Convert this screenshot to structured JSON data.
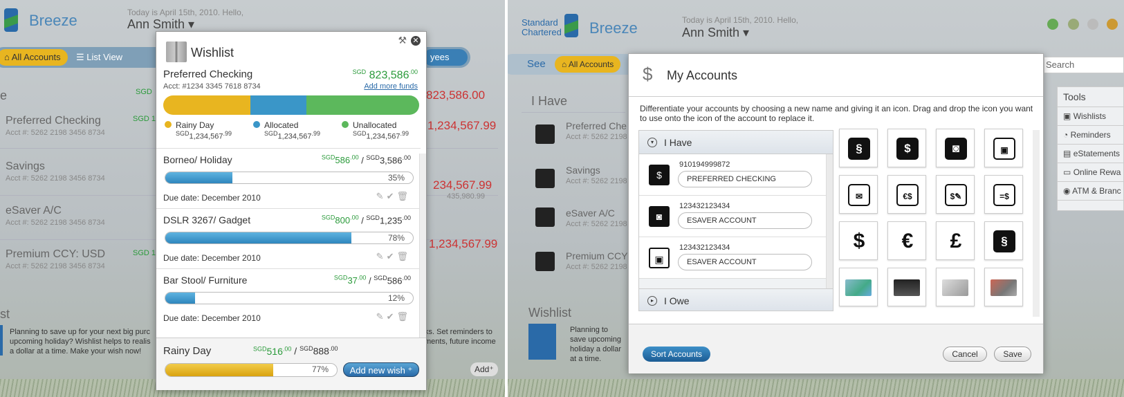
{
  "left": {
    "brand": "Breeze",
    "greeting": "Today is April 15th, 2010. Hello,",
    "user": "Ann Smith",
    "nav": {
      "all_accounts": "All Accounts",
      "list_view": "List View",
      "payees": "yees"
    },
    "section_stub": "e",
    "currency_stub": "SGD",
    "accounts": [
      {
        "name": "Preferred Checking",
        "acct": "Acct #: 5262 2198 3456 8734",
        "cur": "SGD 1",
        "amount": "823,586.00"
      },
      {
        "name": "Savings",
        "acct": "Acct #: 5262 2198 3456 8734",
        "cur": "",
        "amount": "1,234,567.99"
      },
      {
        "name": "eSaver A/C",
        "acct": "Acct #: 5262 2198 3456 8734",
        "cur": "",
        "amount": "234,567.99",
        "sub": "435,980.99"
      },
      {
        "name": "Premium CCY: USD",
        "acct": "Acct #: 5262 2198 3456 8734",
        "cur": "SGD 1",
        "amount": "1,234,567.99"
      }
    ],
    "wishlist_stub": "st",
    "wishlist_text": "Planning to save up for your next big purc upcoming holiday? Wishlist helps to realis a dollar at a time. Make your wish now!",
    "wishlist_text_right": "ks. Set reminders to ments, future income",
    "add_label": "Add"
  },
  "wishlist": {
    "title": "Wishlist",
    "account_name": "Preferred Checking",
    "account_number": "Acct: #1234 3345 7618 8734",
    "balance_currency": "SGD",
    "balance": "823,586",
    "balance_cents": ".00",
    "add_funds": "Add more funds",
    "split": {
      "rainy": 0.34,
      "allocated": 0.22,
      "unallocated": 0.44
    },
    "colors": {
      "rainy": "#e8b520",
      "allocated": "#3a96c8",
      "unallocated": "#5cb85c"
    },
    "legend": [
      {
        "label": "Rainy Day",
        "cur": "SGD",
        "amount": "1,234,567",
        "cents": ".99"
      },
      {
        "label": "Allocated",
        "cur": "SGD",
        "amount": "1,234,567",
        "cents": ".99"
      },
      {
        "label": "Unallocated",
        "cur": "SGD",
        "amount": "1,234,567",
        "cents": ".99"
      }
    ],
    "items": [
      {
        "name": "Borneo/ Holiday",
        "saved": "586",
        "target": "3,586",
        "pct_label": "35%",
        "progress": 0.27,
        "due": "Due date: December 2010"
      },
      {
        "name": "DSLR 3267/ Gadget",
        "saved": "800",
        "target": "1,235",
        "pct_label": "78%",
        "progress": 0.75,
        "due": "Due date: December 2010"
      },
      {
        "name": "Bar Stool/ Furniture",
        "saved": "37",
        "target": "586",
        "pct_label": "12%",
        "progress": 0.12,
        "due": "Due date: December 2010"
      }
    ],
    "rainy": {
      "name": "Rainy Day",
      "saved": "516",
      "target": "888",
      "pct_label": "77%",
      "progress": 0.63
    },
    "add_wish": "Add new wish",
    "cur": "SGD",
    "cents": ".00"
  },
  "right": {
    "brand": "Breeze",
    "sc_line1": "Standard",
    "sc_line2": "Chartered",
    "greeting": "Today is April 15th, 2010. Hello,",
    "user": "Ann Smith",
    "see": "See",
    "all_accounts": "All Accounts",
    "search": "Search",
    "i_have": "I Have",
    "accounts": [
      {
        "name": "Preferred Che",
        "acct": "Acct #: 5262 2198"
      },
      {
        "name": "Savings",
        "acct": "Acct #: 5262 2198"
      },
      {
        "name": "eSaver A/C",
        "acct": "Acct #: 5262 2198"
      },
      {
        "name": "Premium CCY",
        "acct": "Acct #: 5262 2198"
      }
    ],
    "wishlist": "Wishlist",
    "wishlist_text": "Planning to save upcoming holiday a dollar at a time.",
    "tools": {
      "title": "Tools",
      "items": [
        "Wishlists",
        "Reminders",
        "eStatements",
        "Online Rewa",
        "ATM & Branc"
      ]
    }
  },
  "my_accounts": {
    "title": "My Accounts",
    "description": "Differentiate your accounts by choosing a new name and giving it an icon. Drag and drop the icon you want to use onto the icon of the account to replace it.",
    "i_have": "I Have",
    "i_owe": "I Owe",
    "accounts": [
      {
        "number": "910194999872",
        "name": "PREFERRED CHECKING",
        "icon": "money-bag-icon"
      },
      {
        "number": "123432123434",
        "name": "ESAVER ACCOUNT",
        "icon": "safe-icon"
      },
      {
        "number": "123432123434",
        "name": "ESAVER ACCOUNT",
        "icon": "wallet-icon"
      }
    ],
    "icons": [
      "bank-s-icon",
      "money-bag-icon",
      "safe-icon",
      "wallet-icon",
      "envelope-icon",
      "cash-coins-icon",
      "cheque-icon",
      "banknote-icon",
      "dollar-icon",
      "euro-icon",
      "pound-icon",
      "card-s-icon",
      "credit-card-blue-icon",
      "credit-card-black-icon",
      "credit-card-silver-icon",
      "credit-card-red-icon"
    ],
    "sort": "Sort Accounts",
    "cancel": "Cancel",
    "save": "Save"
  }
}
